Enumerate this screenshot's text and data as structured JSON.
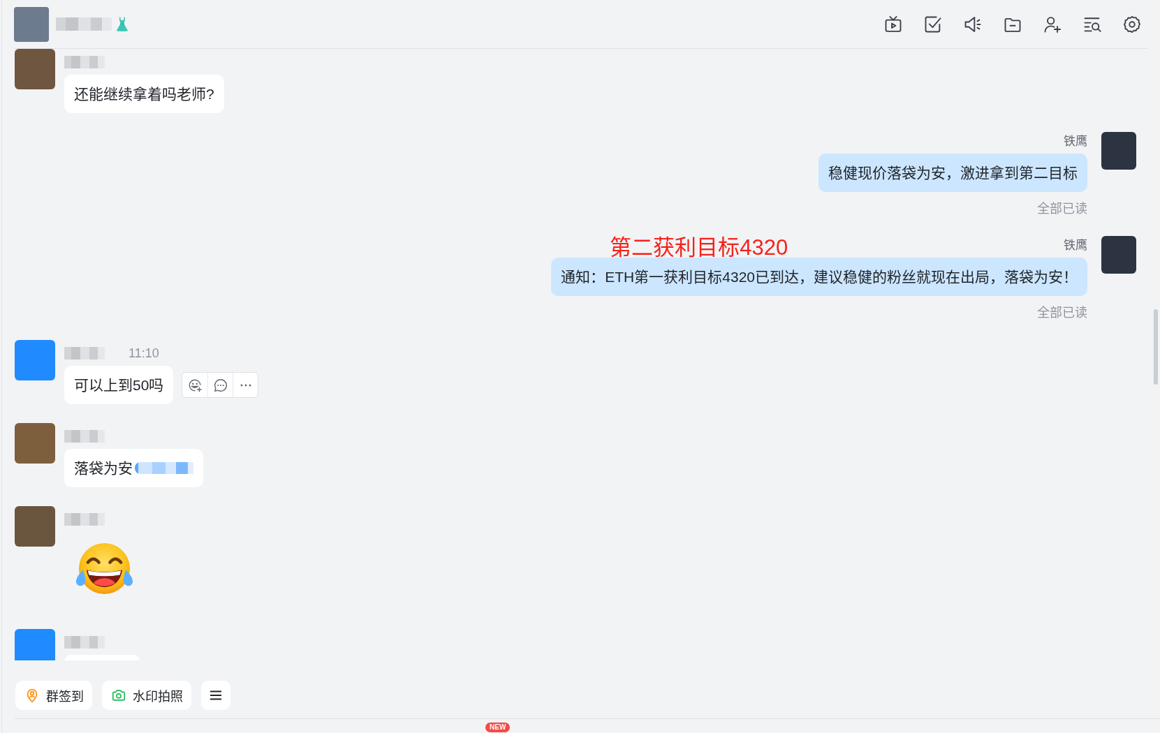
{
  "header": {
    "avatar": {
      "color": "#6d7b8e"
    },
    "title_hidden": true,
    "tools": [
      {
        "kind": "live"
      },
      {
        "kind": "todo"
      },
      {
        "kind": "announcement"
      },
      {
        "kind": "files"
      },
      {
        "kind": "add-member"
      },
      {
        "kind": "search"
      },
      {
        "kind": "settings"
      }
    ]
  },
  "messages": [
    {
      "outgoing": false,
      "avatar": {
        "color": "#6e5640"
      },
      "sender_hidden": true,
      "kind": "text",
      "text": "还能继续拿着吗老师?",
      "blurred_suffix": false,
      "hovered": false
    },
    {
      "outgoing": true,
      "avatar": {
        "color": "#2c3442"
      },
      "sender_hidden": false,
      "sender": "铁鹰",
      "kind": "text",
      "text": "稳健现价落袋为安，激进拿到第二目标",
      "blurred_suffix": false,
      "hovered": false,
      "read_status": "全部已读"
    },
    {
      "outgoing": true,
      "avatar": {
        "color": "#2c3442"
      },
      "sender_hidden": false,
      "sender": "铁鹰",
      "annotation": "第二获利目标4320",
      "kind": "text",
      "text": "通知：ETH第一获利目标4320已到达，建议稳健的粉丝就现在出局，落袋为安！",
      "blurred_suffix": false,
      "hovered": false,
      "read_status": "全部已读"
    },
    {
      "outgoing": false,
      "avatar": {
        "color": "#1f8bff"
      },
      "sender_hidden": true,
      "time": "11:10",
      "kind": "text",
      "text": "可以上到50吗",
      "blurred_suffix": false,
      "hovered": true
    },
    {
      "outgoing": false,
      "avatar": {
        "color": "#7d5f3e"
      },
      "sender_hidden": true,
      "kind": "text",
      "text": "落袋为安",
      "blurred_suffix": true,
      "hovered": false
    },
    {
      "outgoing": false,
      "avatar": {
        "color": "#6a563f"
      },
      "sender_hidden": true,
      "kind": "sticker",
      "hovered": false
    },
    {
      "outgoing": false,
      "avatar": {
        "color": "#1f8bff"
      },
      "sender_hidden": true,
      "kind": "text",
      "blurred_suffix": false,
      "hovered": false
    }
  ],
  "quick_actions": [
    {
      "kind": "check-in",
      "label": "群签到"
    },
    {
      "kind": "camera",
      "label": "水印拍照"
    },
    {
      "kind": "menu"
    }
  ],
  "input_toolbar": {
    "badge": "NEW"
  }
}
